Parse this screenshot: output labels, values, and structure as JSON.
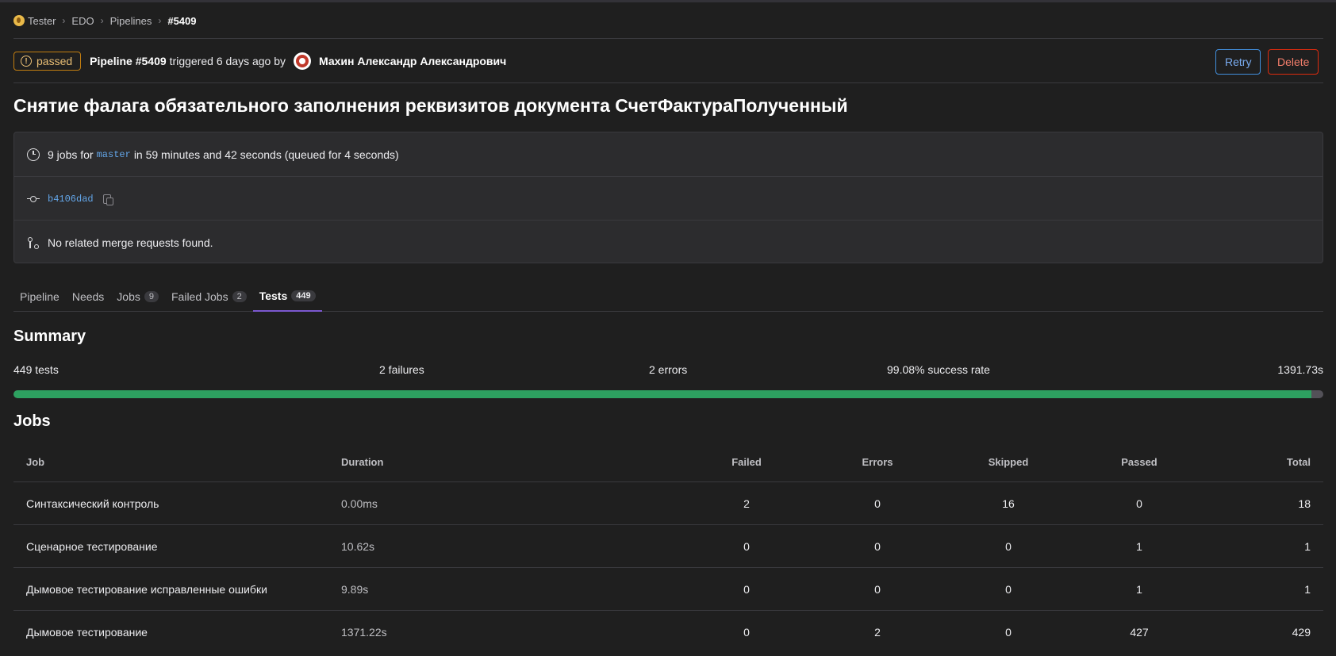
{
  "breadcrumb": {
    "items": [
      "Tester",
      "EDO",
      "Pipelines"
    ],
    "current": "#5409"
  },
  "header": {
    "status": "passed",
    "pipeline_label": "Pipeline #5409",
    "triggered_text": "triggered 6 days ago by",
    "user_name": "Махин Александр Александрович",
    "retry_label": "Retry",
    "delete_label": "Delete"
  },
  "title": "Снятие фалага обязательного заполнения реквизитов документа СчетФактураПолученный",
  "info": {
    "jobs_prefix": "9 jobs for",
    "branch": "master",
    "jobs_suffix": "in 59 minutes and 42 seconds (queued for 4 seconds)",
    "commit_sha": "b4106dad",
    "merge_requests": "No related merge requests found."
  },
  "tabs": [
    {
      "label": "Pipeline",
      "count": ""
    },
    {
      "label": "Needs",
      "count": ""
    },
    {
      "label": "Jobs",
      "count": "9"
    },
    {
      "label": "Failed Jobs",
      "count": "2"
    },
    {
      "label": "Tests",
      "count": "449"
    }
  ],
  "summary": {
    "heading": "Summary",
    "tests": "449 tests",
    "failures": "2 failures",
    "errors": "2 errors",
    "success_rate": "99.08% success rate",
    "duration": "1391.73s",
    "success_fraction": 0.9908
  },
  "jobs": {
    "heading": "Jobs",
    "columns": [
      "Job",
      "Duration",
      "Failed",
      "Errors",
      "Skipped",
      "Passed",
      "Total"
    ],
    "rows": [
      {
        "job": "Синтаксический контроль",
        "duration": "0.00ms",
        "failed": "2",
        "errors": "0",
        "skipped": "16",
        "passed": "0",
        "total": "18"
      },
      {
        "job": "Сценарное тестирование",
        "duration": "10.62s",
        "failed": "0",
        "errors": "0",
        "skipped": "0",
        "passed": "1",
        "total": "1"
      },
      {
        "job": "Дымовое тестирование исправленные ошибки",
        "duration": "9.89s",
        "failed": "0",
        "errors": "0",
        "skipped": "0",
        "passed": "1",
        "total": "1"
      },
      {
        "job": "Дымовое тестирование",
        "duration": "1371.22s",
        "failed": "0",
        "errors": "2",
        "skipped": "0",
        "passed": "427",
        "total": "429"
      }
    ]
  }
}
